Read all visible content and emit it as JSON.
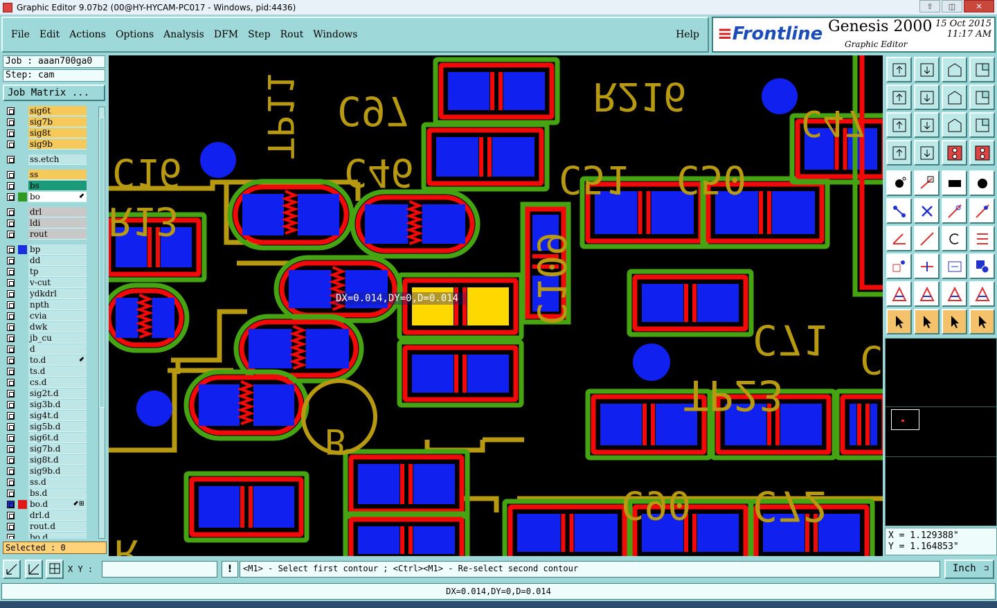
{
  "window": {
    "title": "Graphic Editor 9.07b2 (00@HY-HYCAM-PC017 - Windows, pid:4436)",
    "buttons": [
      "⇧",
      "◫",
      "✕"
    ]
  },
  "menu": {
    "items": [
      "File",
      "Edit",
      "Actions",
      "Options",
      "Analysis",
      "DFM",
      "Step",
      "Rout",
      "Windows"
    ],
    "help": "Help"
  },
  "logo": {
    "brand": "Frontline",
    "product": "Genesis 2000",
    "subtitle": "Graphic Editor",
    "date": "15 Oct 2015",
    "time": "11:17 AM"
  },
  "left_panel": {
    "job": "Job : aaan700ga0",
    "step": "Step: cam",
    "job_matrix": "Job Matrix ...",
    "selected": "Selected : 0"
  },
  "layers": [
    {
      "name": "sig6t",
      "color": "#f5c95a",
      "swatch": ""
    },
    {
      "name": "sig7b",
      "color": "#f5c95a",
      "swatch": ""
    },
    {
      "name": "sig8t",
      "color": "#f5c95a",
      "swatch": ""
    },
    {
      "name": "sig9b",
      "color": "#f5c95a",
      "swatch": ""
    },
    {
      "gap": true
    },
    {
      "name": "ss.etch",
      "color": "#bfe6e6",
      "swatch": ""
    },
    {
      "gap": true
    },
    {
      "name": "ss",
      "color": "#f5c95a",
      "swatch": ""
    },
    {
      "name": "bs",
      "color": "#1a9a78",
      "swatch": ""
    },
    {
      "name": "bo",
      "color": "#ffffff",
      "swatch": "#2f9a1f",
      "mark": "⬋"
    },
    {
      "gap": true
    },
    {
      "name": "drl",
      "color": "#c8c8c8",
      "swatch": ""
    },
    {
      "name": "ldi",
      "color": "#c8c8c8",
      "swatch": ""
    },
    {
      "name": "rout",
      "color": "#c8c8c8",
      "swatch": ""
    },
    {
      "gap": true
    },
    {
      "name": "bp",
      "color": "#bfe6e6",
      "swatch": "#1a2ee0"
    },
    {
      "name": "dd",
      "color": "#bfe6e6",
      "swatch": ""
    },
    {
      "name": "tp",
      "color": "#bfe6e6",
      "swatch": ""
    },
    {
      "name": "v-cut",
      "color": "#bfe6e6",
      "swatch": ""
    },
    {
      "name": "ydkdrl",
      "color": "#bfe6e6",
      "swatch": ""
    },
    {
      "name": "npth",
      "color": "#bfe6e6",
      "swatch": ""
    },
    {
      "name": "cvia",
      "color": "#bfe6e6",
      "swatch": ""
    },
    {
      "name": "dwk",
      "color": "#bfe6e6",
      "swatch": ""
    },
    {
      "name": "jb_cu",
      "color": "#bfe6e6",
      "swatch": ""
    },
    {
      "name": "d",
      "color": "#bfe6e6",
      "swatch": ""
    },
    {
      "name": "to.d",
      "color": "#bfe6e6",
      "swatch": "",
      "mark": "⬋"
    },
    {
      "name": "ts.d",
      "color": "#bfe6e6",
      "swatch": ""
    },
    {
      "name": "cs.d",
      "color": "#bfe6e6",
      "swatch": ""
    },
    {
      "name": "sig2t.d",
      "color": "#bfe6e6",
      "swatch": ""
    },
    {
      "name": "sig3b.d",
      "color": "#bfe6e6",
      "swatch": ""
    },
    {
      "name": "sig4t.d",
      "color": "#bfe6e6",
      "swatch": ""
    },
    {
      "name": "sig5b.d",
      "color": "#bfe6e6",
      "swatch": ""
    },
    {
      "name": "sig6t.d",
      "color": "#bfe6e6",
      "swatch": ""
    },
    {
      "name": "sig7b.d",
      "color": "#bfe6e6",
      "swatch": ""
    },
    {
      "name": "sig8t.d",
      "color": "#bfe6e6",
      "swatch": ""
    },
    {
      "name": "sig9b.d",
      "color": "#bfe6e6",
      "swatch": ""
    },
    {
      "name": "ss.d",
      "color": "#bfe6e6",
      "swatch": ""
    },
    {
      "name": "bs.d",
      "color": "#bfe6e6",
      "swatch": ""
    },
    {
      "name": "bo.d",
      "color": "#bfe6e6",
      "swatch": "#e01818",
      "mark": "⬋⊞",
      "active": true
    },
    {
      "name": "drl.d",
      "color": "#bfe6e6",
      "swatch": ""
    },
    {
      "name": "rout.d",
      "color": "#bfe6e6",
      "swatch": ""
    },
    {
      "name": "bo.d",
      "color": "#bfe6e6",
      "swatch": ""
    }
  ],
  "canvas": {
    "measure_label": "DX=0.014,DY=0,D=0.014",
    "silk_labels": [
      "TP11",
      "C97",
      "R216",
      "C47",
      "C16",
      "C46",
      "C51",
      "C50",
      "R13",
      "C71",
      "C109",
      "TP23",
      "B",
      "C90",
      "C72",
      "R",
      "C"
    ]
  },
  "toolbar_icons": [
    "zoom-home-icon",
    "zoom-fit-icon",
    "zoom-profile-icon",
    "window-icon",
    "pan-left-icon",
    "pan-right-icon",
    "zoom-in-icon",
    "zoom-out-icon",
    "fit-screen-icon",
    "center-icon",
    "scale-1to2-icon",
    "help-icon",
    "measure-tool-icon",
    "grid-icon",
    "layers-red-icon",
    "layers-red2-icon",
    "snap-point-icon",
    "snap-line-icon",
    "snap-pad-icon",
    "snap-center-icon",
    "node-icon",
    "cross-icon",
    "line-icon",
    "line-point-icon",
    "angle-icon",
    "diagonal-icon",
    "rotate-icon",
    "mirror-icon",
    "square-point-icon",
    "midline-icon",
    "frame-icon",
    "layers-icon",
    "triangle-1-icon",
    "triangle-2-icon",
    "triangle-3-icon",
    "triangle-4-icon",
    "pointer-icon",
    "pointer-select-icon",
    "pointer-circle-icon",
    "pointer-route-icon"
  ],
  "coordinates": {
    "x": "X = 1.129388\"",
    "y": "Y = 1.164853\""
  },
  "bottom": {
    "xy_label": "X Y :",
    "xy_value": "",
    "prompt": "<M1> - Select first contour ; <Ctrl><M1> - Re-select second contour",
    "unit": "Inch",
    "status": "DX=0.014,DY=0,D=0.014",
    "excl": "!"
  }
}
